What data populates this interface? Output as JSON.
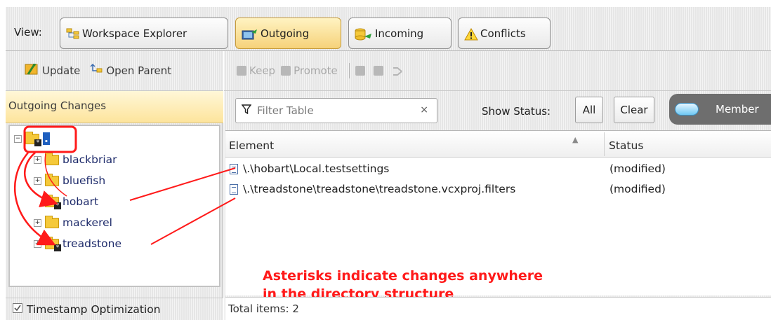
{
  "view_bar": {
    "label": "View:",
    "buttons": [
      {
        "label": "Workspace Explorer",
        "icon": "workspace-explorer-icon",
        "active": false
      },
      {
        "label": "Outgoing",
        "icon": "outgoing-icon",
        "active": true
      },
      {
        "label": "Incoming",
        "icon": "incoming-icon",
        "active": false
      },
      {
        "label": "Conflicts",
        "icon": "warning-icon",
        "active": false
      }
    ]
  },
  "left_toolbar": {
    "update_label": "Update",
    "open_parent_label": "Open Parent"
  },
  "outgoing_header": "Outgoing Changes",
  "tree": {
    "root_label": ".",
    "items": [
      {
        "label": "blackbriar",
        "modified": false
      },
      {
        "label": "bluefish",
        "modified": false
      },
      {
        "label": "hobart",
        "modified": true
      },
      {
        "label": "mackerel",
        "modified": false
      },
      {
        "label": "treadstone",
        "modified": true
      }
    ]
  },
  "left_footer": {
    "timestamp_label": "Timestamp Optimization",
    "checked": true
  },
  "right_toolbar": {
    "keep_label": "Keep",
    "promote_label": "Promote"
  },
  "filter": {
    "placeholder": "Filter Table",
    "clear_glyph": "×"
  },
  "show_status": {
    "label": "Show Status:",
    "all_label": "All",
    "clear_label": "Clear",
    "members_label": "Member"
  },
  "table": {
    "columns": [
      "Element",
      "Status"
    ],
    "rows": [
      {
        "element": "\\.\\hobart\\Local.testsettings",
        "status": "(modified)"
      },
      {
        "element": "\\.\\treadstone\\treadstone\\treadstone.vcxproj.filters",
        "status": "(modified)"
      }
    ]
  },
  "annotation": {
    "line1": "Asterisks indicate changes anywhere",
    "line2": "in the directory structure"
  },
  "status_bar": "Total items: 2",
  "colors": {
    "annotation_red": "#ff1a1a",
    "active_button": "#f6d27a",
    "folder_yellow": "#f5c93a"
  }
}
